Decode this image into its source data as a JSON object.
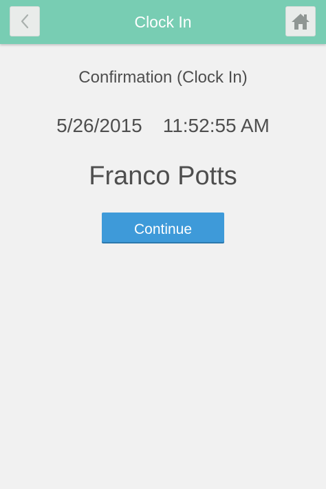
{
  "header": {
    "title": "Clock In",
    "back_icon": "chevron-left-icon",
    "home_icon": "home-icon"
  },
  "confirmation": {
    "title": "Confirmation (Clock In)",
    "date": "5/26/2015",
    "time": "11:52:55 AM",
    "employee_name": "Franco Potts"
  },
  "actions": {
    "continue_label": "Continue"
  },
  "colors": {
    "header_bg": "#78cdb3",
    "button_bg": "#3e9ad9",
    "page_bg": "#f1f1f1"
  }
}
